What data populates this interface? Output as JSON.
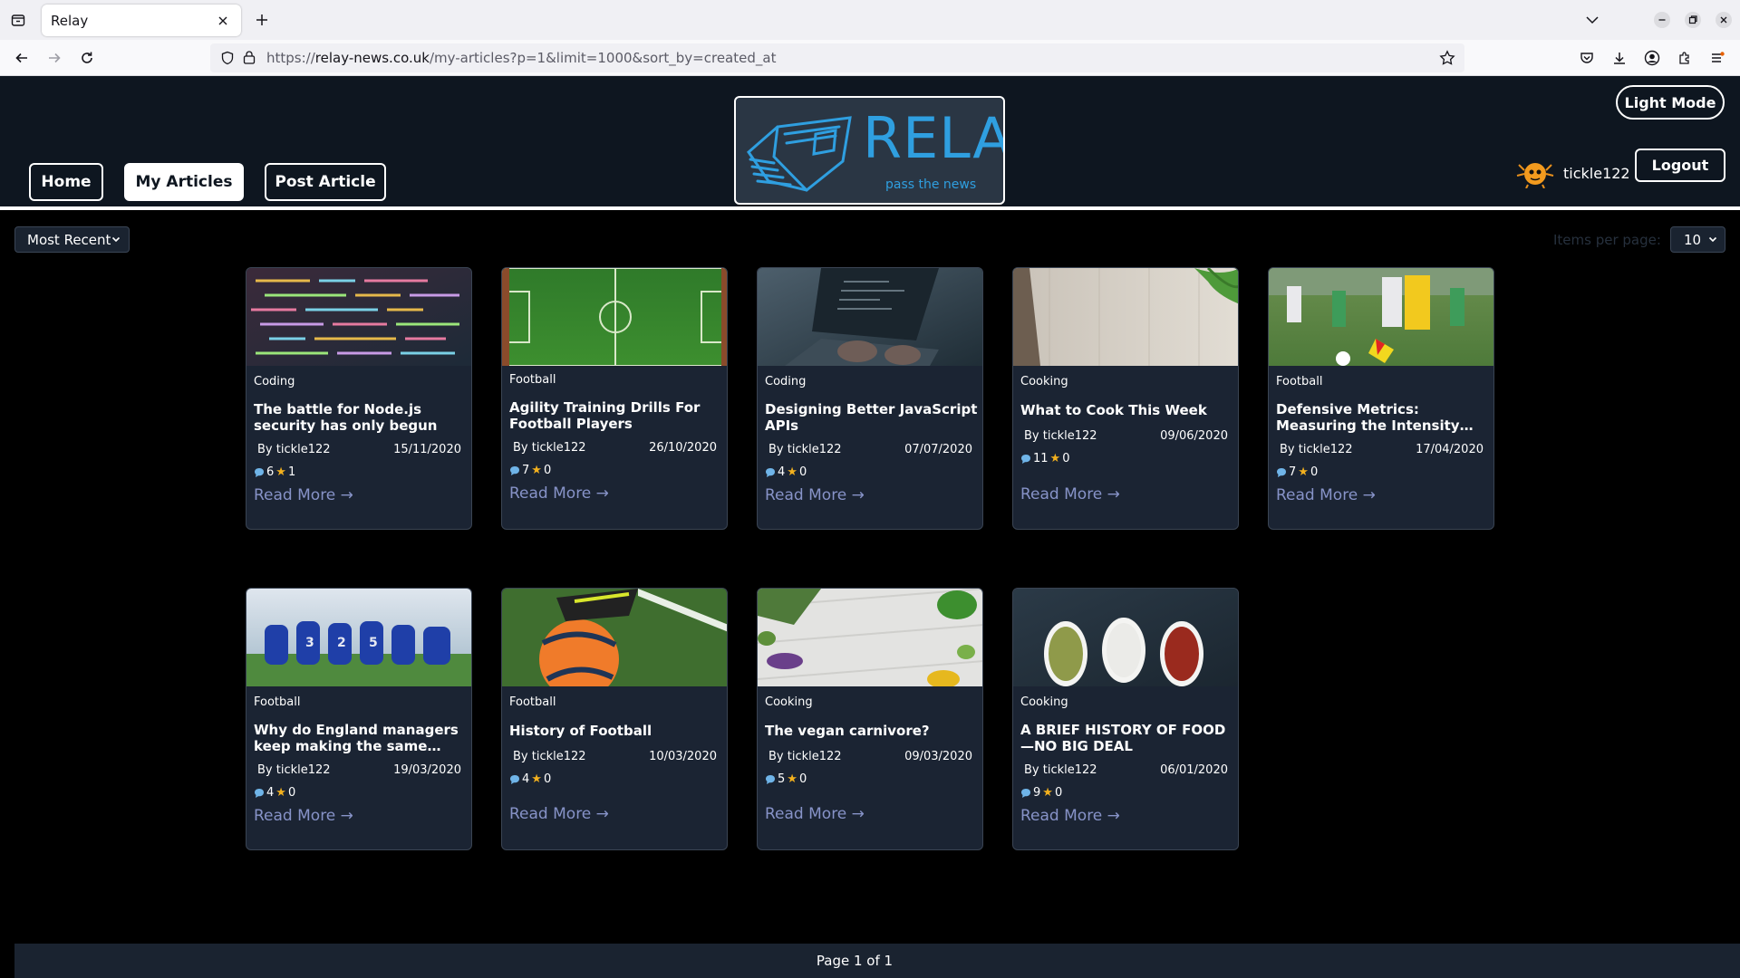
{
  "browser": {
    "tab_title": "Relay",
    "url_prefix": "https://",
    "url_host": "relay-news.co.uk",
    "url_path": "/my-articles?p=1&limit=1000&sort_by=created_at"
  },
  "header": {
    "nav": [
      "Home",
      "My Articles",
      "Post Article"
    ],
    "logo_text": "RELAY",
    "logo_tagline": "pass the news",
    "light_mode_label": "Light Mode",
    "logout_label": "Logout",
    "username": "tickle122"
  },
  "controls": {
    "sort_value": "Most Recent",
    "items_per_page_label": "Items per page:",
    "items_per_page_value": "10"
  },
  "articles": [
    {
      "category": "Coding",
      "title": "The battle for Node.js security has only begun",
      "author": "By tickle122",
      "date": "15/11/2020",
      "comments": "6",
      "votes": "1",
      "read_more": "Read More →"
    },
    {
      "category": "Football",
      "title": "Agility Training Drills For Football Players",
      "author": "By tickle122",
      "date": "26/10/2020",
      "comments": "7",
      "votes": "0",
      "read_more": "Read More →"
    },
    {
      "category": "Coding",
      "title": "Designing Better JavaScript APIs",
      "author": "By tickle122",
      "date": "07/07/2020",
      "comments": "4",
      "votes": "0",
      "read_more": "Read More →"
    },
    {
      "category": "Cooking",
      "title": "What to Cook This Week",
      "author": "By tickle122",
      "date": "09/06/2020",
      "comments": "11",
      "votes": "0",
      "read_more": "Read More →"
    },
    {
      "category": "Football",
      "title": "Defensive Metrics: Measuring the Intensity of…",
      "author": "By tickle122",
      "date": "17/04/2020",
      "comments": "7",
      "votes": "0",
      "read_more": "Read More →"
    },
    {
      "category": "Football",
      "title": "Why do England managers keep making the same…",
      "author": "By tickle122",
      "date": "19/03/2020",
      "comments": "4",
      "votes": "0",
      "read_more": "Read More →"
    },
    {
      "category": "Football",
      "title": "History of Football",
      "author": "By tickle122",
      "date": "10/03/2020",
      "comments": "4",
      "votes": "0",
      "read_more": "Read More →"
    },
    {
      "category": "Cooking",
      "title": "The vegan carnivore?",
      "author": "By tickle122",
      "date": "09/03/2020",
      "comments": "5",
      "votes": "0",
      "read_more": "Read More →"
    },
    {
      "category": "Cooking",
      "title": "A BRIEF HISTORY OF FOOD—NO BIG DEAL",
      "author": "By tickle122",
      "date": "06/01/2020",
      "comments": "9",
      "votes": "0",
      "read_more": "Read More →"
    }
  ],
  "pagination": {
    "text": "Page 1 of 1"
  },
  "colors": {
    "header_bg": "#0e1620",
    "card_bg": "#1b2433",
    "logo_blue": "#2f9fe0",
    "link": "#8793c8"
  }
}
